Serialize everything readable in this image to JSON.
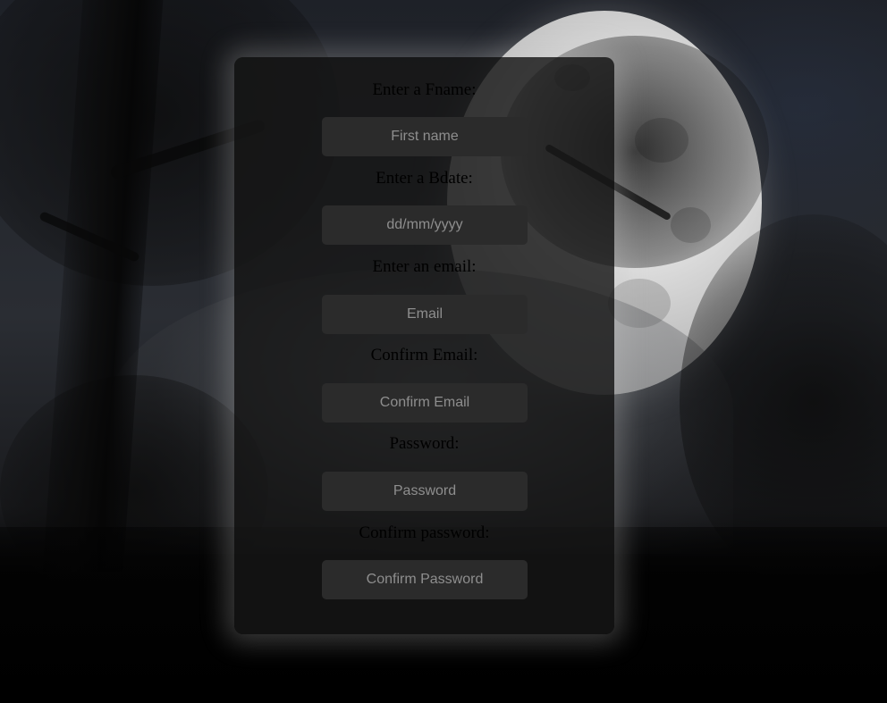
{
  "form": {
    "fields": [
      {
        "label": "Enter a Fname:",
        "placeholder": "First name",
        "type": "text"
      },
      {
        "label": "Enter a Bdate:",
        "placeholder": "dd/mm/yyyy",
        "type": "text"
      },
      {
        "label": "Enter an email:",
        "placeholder": "Email",
        "type": "email"
      },
      {
        "label": "Confirm Email:",
        "placeholder": "Confirm Email",
        "type": "email"
      },
      {
        "label": "Password:",
        "placeholder": "Password",
        "type": "password"
      },
      {
        "label": "Confirm password:",
        "placeholder": "Confirm Password",
        "type": "password"
      }
    ]
  },
  "colors": {
    "card_background": "#161616",
    "input_background": "#2b2b2b",
    "label_text": "#000000",
    "placeholder_text": "#8e8e8e"
  }
}
